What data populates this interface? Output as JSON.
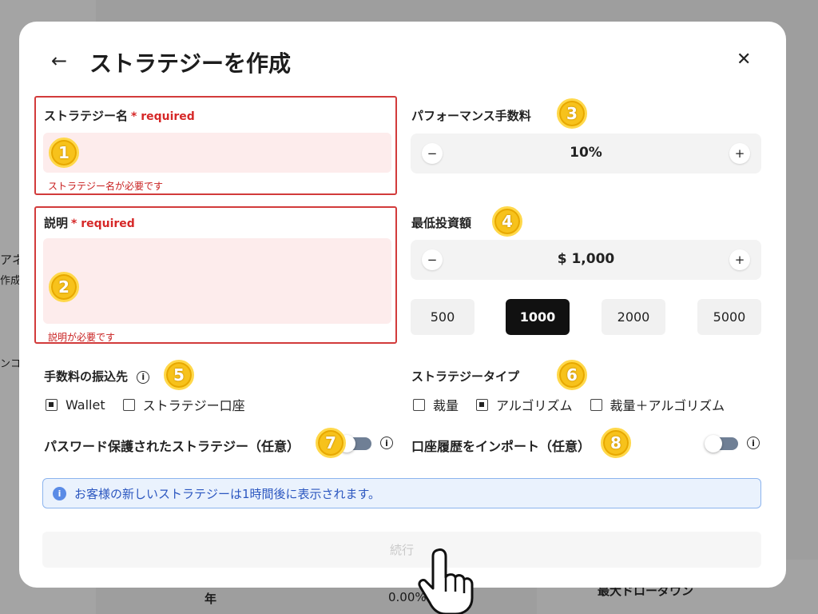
{
  "background": {
    "year_label": "年",
    "percent_value": "0.00%",
    "right_label": "最大ドローダウン",
    "left_fragments": [
      "アネ",
      "作成と",
      "ンコー"
    ]
  },
  "modal": {
    "title": "ストラテジーを作成",
    "back_icon": "arrow-left-icon",
    "close_icon": "close-icon",
    "name_field": {
      "label": "ストラテジー名",
      "required": "* required",
      "error": "ストラテジー名が必要です",
      "badge": "1"
    },
    "description_field": {
      "label": "説明",
      "required": "* required",
      "error": "説明が必要です",
      "badge": "2"
    },
    "performance_fee": {
      "label": "パフォーマンス手数料",
      "value": "10%",
      "minus": "−",
      "plus": "+",
      "badge": "3"
    },
    "min_investment": {
      "label": "最低投資額",
      "value": "$ 1,000",
      "minus": "−",
      "plus": "+",
      "badge": "4",
      "presets": [
        "500",
        "1000",
        "2000",
        "5000"
      ],
      "selected_preset": "1000"
    },
    "fee_destination": {
      "label": "手数料の振込先",
      "badge": "5",
      "options": [
        "Wallet",
        "ストラテジー口座"
      ],
      "selected": "Wallet"
    },
    "strategy_type": {
      "label": "ストラテジータイプ",
      "badge": "6",
      "options": [
        "裁量",
        "アルゴリズム",
        "裁量＋アルゴリズム"
      ],
      "selected": "アルゴリズム"
    },
    "password_protected": {
      "label": "パスワード保護されたストラテジー（任意）",
      "badge": "7",
      "enabled": false
    },
    "import_history": {
      "label": "口座履歴をインポート（任意）",
      "badge": "8",
      "enabled": false
    },
    "notice": "お客様の新しいストラテジーは1時間後に表示されます。",
    "continue_label": "続行"
  },
  "colors": {
    "error": "#d23b3b",
    "badge": "#f7c21b",
    "notice_bg": "#eaf2fd",
    "notice_text": "#2c57c0",
    "toggle": "#6f7f95"
  }
}
